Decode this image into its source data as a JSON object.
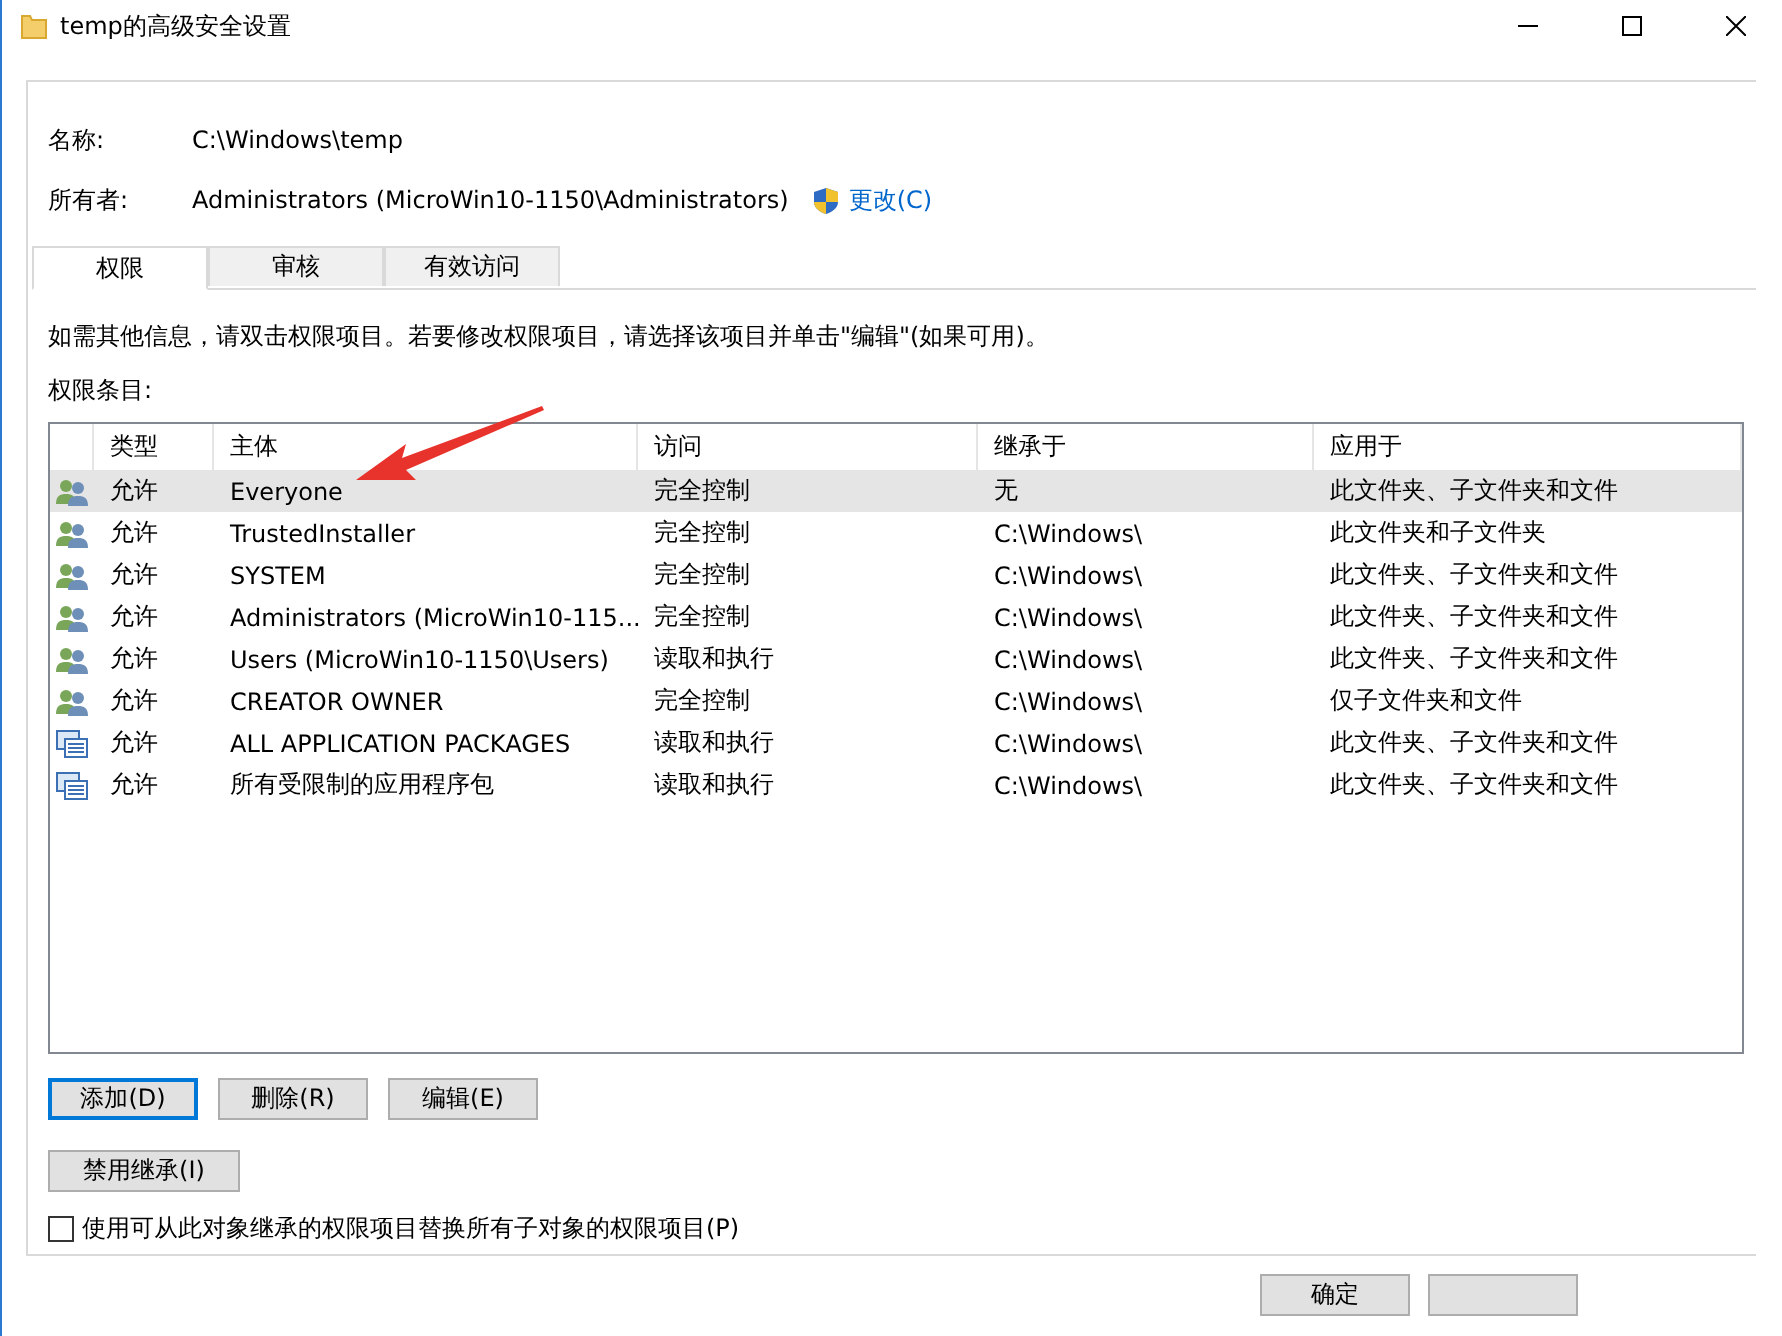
{
  "window": {
    "title": "temp的高级安全设置"
  },
  "fields": [
    {
      "label": "名称:",
      "value": "C:\\Windows\\temp"
    },
    {
      "label": "所有者:",
      "value": "Administrators (MicroWin10-1150\\Administrators)",
      "link": "更改(C)"
    }
  ],
  "tabs": [
    {
      "label": "权限",
      "selected": true
    },
    {
      "label": "审核",
      "selected": false
    },
    {
      "label": "有效访问",
      "selected": false
    }
  ],
  "info_text": "如需其他信息，请双击权限项目。若要修改权限项目，请选择该项目并单击\"编辑\"(如果可用)。",
  "list_label": "权限条目:",
  "table": {
    "columns": [
      "类型",
      "主体",
      "访问",
      "继承于",
      "应用于"
    ],
    "rows": [
      {
        "kind": "user",
        "selected": true,
        "cells": [
          "允许",
          "Everyone",
          "完全控制",
          "无",
          "此文件夹、子文件夹和文件"
        ]
      },
      {
        "kind": "user",
        "selected": false,
        "cells": [
          "允许",
          "TrustedInstaller",
          "完全控制",
          "C:\\Windows\\",
          "此文件夹和子文件夹"
        ]
      },
      {
        "kind": "user",
        "selected": false,
        "cells": [
          "允许",
          "SYSTEM",
          "完全控制",
          "C:\\Windows\\",
          "此文件夹、子文件夹和文件"
        ]
      },
      {
        "kind": "user",
        "selected": false,
        "cells": [
          "允许",
          "Administrators (MicroWin10-115...",
          "完全控制",
          "C:\\Windows\\",
          "此文件夹、子文件夹和文件"
        ]
      },
      {
        "kind": "user",
        "selected": false,
        "cells": [
          "允许",
          "Users (MicroWin10-1150\\Users)",
          "读取和执行",
          "C:\\Windows\\",
          "此文件夹、子文件夹和文件"
        ]
      },
      {
        "kind": "user",
        "selected": false,
        "cells": [
          "允许",
          "CREATOR OWNER",
          "完全控制",
          "C:\\Windows\\",
          "仅子文件夹和文件"
        ]
      },
      {
        "kind": "package",
        "selected": false,
        "cells": [
          "允许",
          "ALL APPLICATION PACKAGES",
          "读取和执行",
          "C:\\Windows\\",
          "此文件夹、子文件夹和文件"
        ]
      },
      {
        "kind": "package",
        "selected": false,
        "cells": [
          "允许",
          "所有受限制的应用程序包",
          "读取和执行",
          "C:\\Windows\\",
          "此文件夹、子文件夹和文件"
        ]
      }
    ]
  },
  "action_buttons": [
    {
      "label": "添加(D)",
      "focused": true
    },
    {
      "label": "删除(R)",
      "focused": false
    },
    {
      "label": "编辑(E)",
      "focused": false
    }
  ],
  "inherit_button": "禁用继承(I)",
  "replace_checkbox": {
    "label": "使用可从此对象继承的权限项目替换所有子对象的权限项目(P)",
    "checked": false
  },
  "dialog_buttons": [
    "确定"
  ]
}
